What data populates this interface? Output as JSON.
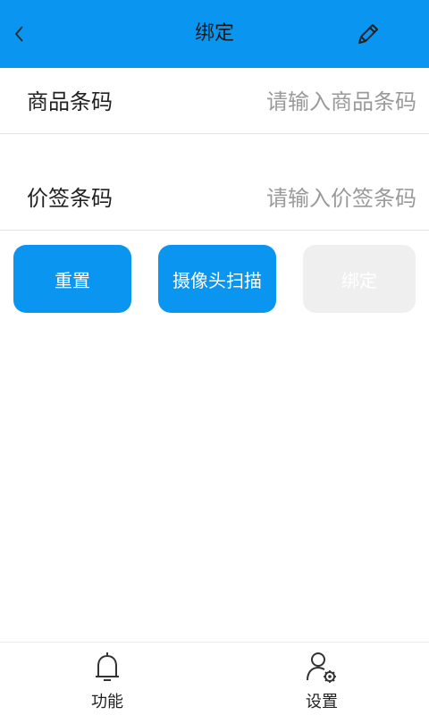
{
  "header": {
    "title": "绑定",
    "back_icon": "chevron-left-icon",
    "edit_icon": "pencil-icon",
    "bg_color": "#0A95F0"
  },
  "form": {
    "barcode": {
      "label": "商品条码",
      "placeholder": "请输入商品条码",
      "value": ""
    },
    "tag": {
      "label": "价签条码",
      "placeholder": "请输入价签条码",
      "value": ""
    }
  },
  "buttons": {
    "reset": "重置",
    "scan": "摄像头扫描",
    "bind": "绑定",
    "bind_disabled": true
  },
  "tabbar": {
    "items": [
      {
        "label": "功能",
        "icon": "bell-icon"
      },
      {
        "label": "设置",
        "icon": "user-settings-icon"
      }
    ]
  }
}
